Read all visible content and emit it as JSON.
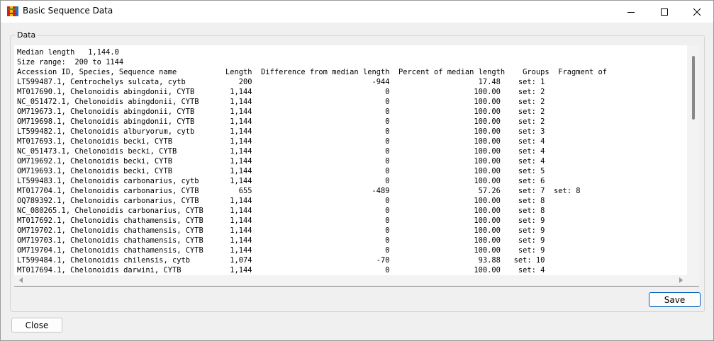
{
  "window": {
    "title": "Basic Sequence Data"
  },
  "group": {
    "label": "Data"
  },
  "lines": [
    "Median length   1,144.0",
    "Size range:  200 to 1144",
    "Accession ID, Species, Sequence name           Length  Difference from median length  Percent of median length    Groups  Fragment of",
    "LT599487.1, Centrochelys sulcata, cytb            200                           -944                    17.48    set: 1",
    "MT017690.1, Chelonoidis abingdonii, CYTB        1,144                              0                   100.00    set: 2",
    "NC_051472.1, Chelonoidis abingdonii, CYTB       1,144                              0                   100.00    set: 2",
    "OM719673.1, Chelonoidis abingdonii, CYTB        1,144                              0                   100.00    set: 2",
    "OM719698.1, Chelonoidis abingdonii, CYTB        1,144                              0                   100.00    set: 2",
    "LT599482.1, Chelonoidis alburyorum, cytb        1,144                              0                   100.00    set: 3",
    "MT017693.1, Chelonoidis becki, CYTB             1,144                              0                   100.00    set: 4",
    "NC_051473.1, Chelonoidis becki, CYTB            1,144                              0                   100.00    set: 4",
    "OM719692.1, Chelonoidis becki, CYTB             1,144                              0                   100.00    set: 4",
    "OM719693.1, Chelonoidis becki, CYTB             1,144                              0                   100.00    set: 5",
    "LT599483.1, Chelonoidis carbonarius, cytb       1,144                              0                   100.00    set: 6",
    "MT017704.1, Chelonoidis carbonarius, CYTB         655                           -489                    57.26    set: 7  set: 8",
    "OQ789392.1, Chelonoidis carbonarius, CYTB       1,144                              0                   100.00    set: 8",
    "NC_080265.1, Chelonoidis carbonarius, CYTB      1,144                              0                   100.00    set: 8",
    "MT017692.1, Chelonoidis chathamensis, CYTB      1,144                              0                   100.00    set: 9",
    "OM719702.1, Chelonoidis chathamensis, CYTB      1,144                              0                   100.00    set: 9",
    "OM719703.1, Chelonoidis chathamensis, CYTB      1,144                              0                   100.00    set: 9",
    "OM719704.1, Chelonoidis chathamensis, CYTB      1,144                              0                   100.00    set: 9",
    "LT599484.1, Chelonoidis chilensis, cytb         1,074                            -70                    93.88   set: 10",
    "MT017694.1, Chelonoidis darwini, CYTB           1,144                              0                   100.00    set: 4"
  ],
  "buttons": {
    "save": "Save",
    "close": "Close"
  },
  "colors": {
    "accent": "#005fb8"
  }
}
